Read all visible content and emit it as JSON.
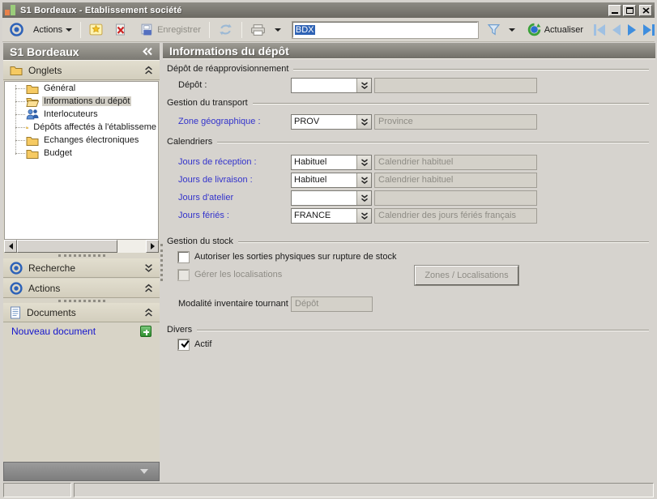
{
  "colors": {
    "label_link": "#3333cc",
    "selection_bg": "#2f63b5",
    "header_gray": "#7c7a73",
    "accent_green": "#2e8f2e"
  },
  "window": {
    "title": "S1 Bordeaux - Etablissement société"
  },
  "toolbar": {
    "actions_label": "Actions",
    "save_label": "Enregistrer",
    "record_input_value": "BDX",
    "refresh_label": "Actualiser"
  },
  "sidebar": {
    "title": "S1 Bordeaux",
    "onglets_label": "Onglets",
    "tree": [
      {
        "label": "Général",
        "selected": false
      },
      {
        "label": "Informations du dépôt",
        "selected": true
      },
      {
        "label": "Interlocuteurs",
        "selected": false
      },
      {
        "label": "Dépôts affectés à l'établisseme",
        "selected": false
      },
      {
        "label": "Echanges électroniques",
        "selected": false
      },
      {
        "label": "Budget",
        "selected": false
      }
    ],
    "recherche_label": "Recherche",
    "actions_label": "Actions",
    "documents_label": "Documents",
    "new_document_label": "Nouveau document"
  },
  "main": {
    "title": "Informations du dépôt",
    "groups": {
      "reappro": "Dépôt de réapprovisionnement",
      "transport": "Gestion du transport",
      "calendriers": "Calendriers",
      "stock": "Gestion du stock",
      "divers": "Divers"
    },
    "fields": {
      "depot": {
        "label": "Dépôt :",
        "value": "",
        "desc": ""
      },
      "zone": {
        "label": "Zone géographique :",
        "value": "PROV",
        "desc": "Province"
      },
      "reception": {
        "label": "Jours de réception :",
        "value": "Habituel",
        "desc": "Calendrier habituel"
      },
      "livraison": {
        "label": "Jours de livraison :",
        "value": "Habituel",
        "desc": "Calendrier habituel"
      },
      "atelier": {
        "label": "Jours d'atelier",
        "value": "",
        "desc": ""
      },
      "feries": {
        "label": "Jours fériés :",
        "value": "FRANCE",
        "desc": "Calendrier des jours fériés français"
      }
    },
    "stock": {
      "check_rupture": "Autoriser les sorties physiques sur rupture de stock",
      "check_localisations": "Gérer les localisations",
      "zones_button": "Zones / Localisations",
      "modalite_label": "Modalité inventaire tournant :",
      "modalite_value": "Dépôt"
    },
    "divers": {
      "check_actif": "Actif"
    }
  }
}
